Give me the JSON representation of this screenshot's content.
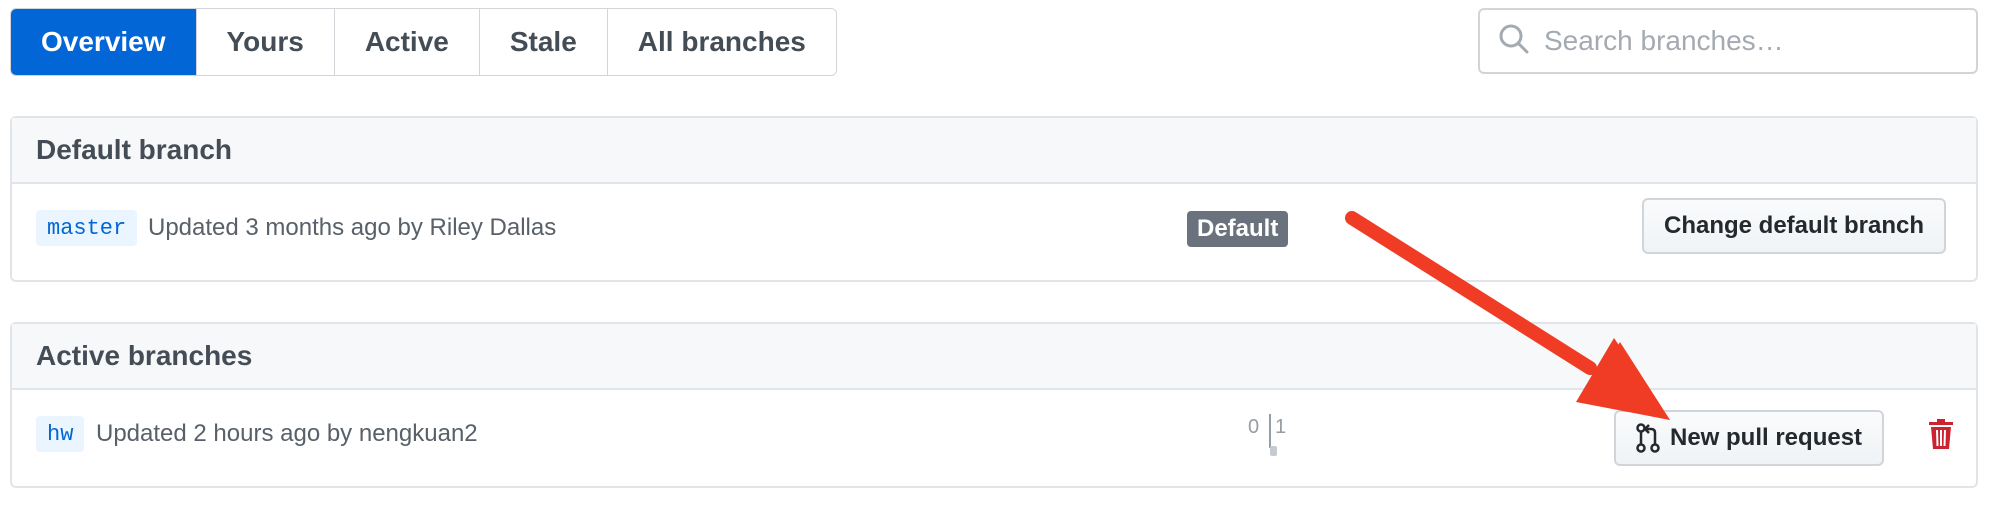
{
  "tabs": [
    {
      "label": "Overview",
      "selected": true
    },
    {
      "label": "Yours"
    },
    {
      "label": "Active"
    },
    {
      "label": "Stale"
    },
    {
      "label": "All branches"
    }
  ],
  "search": {
    "placeholder": "Search branches…",
    "icon": "search-icon"
  },
  "default_section": {
    "title": "Default branch",
    "branch": {
      "name": "master",
      "updated": "Updated 3 months ago by",
      "author": "Riley Dallas",
      "label": "Default",
      "action_label": "Change default branch"
    }
  },
  "active_section": {
    "title": "Active branches",
    "branch": {
      "name": "hw",
      "updated": "Updated 2 hours ago by",
      "author": "nengkuan2",
      "behind": "0",
      "ahead": "1",
      "pr_label": "New pull request",
      "pr_icon": "git-pull-request-icon",
      "delete_icon": "trash-icon"
    }
  },
  "colors": {
    "accent": "#0366d6",
    "annotation_arrow": "#f03c24",
    "delete": "#cb2431",
    "default_label_bg": "#6a737d"
  }
}
